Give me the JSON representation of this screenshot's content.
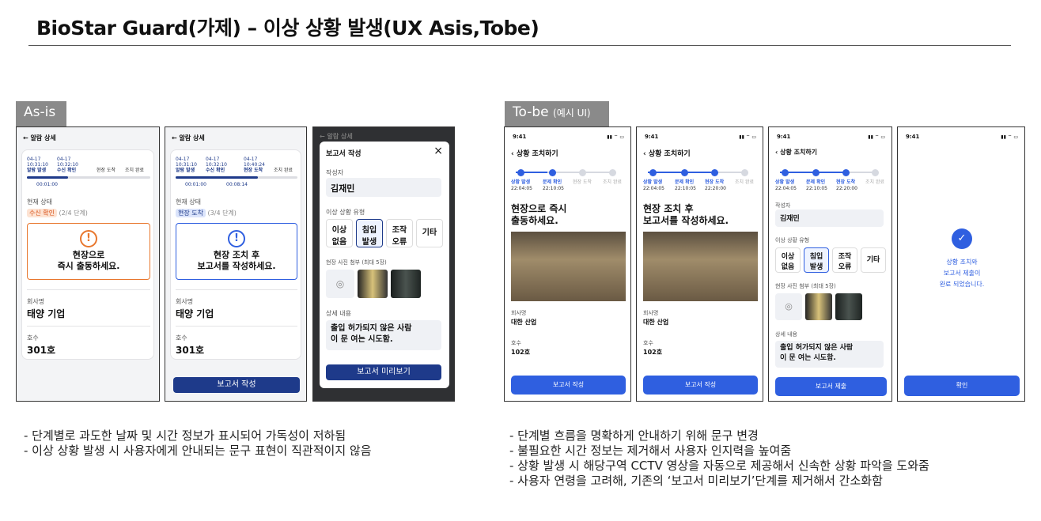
{
  "page_title": "BioStar Guard(가제) – 이상 상황 발생(UX Asis,Tobe)",
  "asis": {
    "tag": "As-is",
    "screen1": {
      "header": "알람 상세",
      "steps_top": [
        {
          "date": "04-17",
          "time": "10:31:10",
          "label": "알람 발생"
        },
        {
          "date": "04-17",
          "time": "10:32:10",
          "label": "수신 확인"
        },
        {
          "date": "",
          "time": "",
          "label": "현장 도착"
        },
        {
          "date": "",
          "time": "",
          "label": "조치 완료"
        }
      ],
      "elapsed": [
        "00:01:00"
      ],
      "status_label": "현재 상태",
      "status_badge": "수신 확인",
      "status_step": "(2/4 단계)",
      "alert_line1": "현장으로",
      "alert_line2": "즉시 출동하세요.",
      "company_label": "회사명",
      "company_value": "태양 기업",
      "room_label": "호수",
      "room_value": "301호"
    },
    "screen2": {
      "header": "알람 상세",
      "steps_top": [
        {
          "date": "04-17",
          "time": "10:31:10",
          "label": "알람 발생"
        },
        {
          "date": "04-17",
          "time": "10:32:10",
          "label": "수신 확인"
        },
        {
          "date": "04-17",
          "time": "10:40:24",
          "label": "현장 도착"
        },
        {
          "date": "",
          "time": "",
          "label": "조치 완료"
        }
      ],
      "elapsed": [
        "00:01:00",
        "00:08:14"
      ],
      "status_label": "현재 상태",
      "status_badge": "현장 도착",
      "status_step": "(3/4 단계)",
      "alert_line1": "현장 조치 후",
      "alert_line2": "보고서를 작성하세요.",
      "company_label": "회사명",
      "company_value": "태양 기업",
      "room_label": "호수",
      "room_value": "301호",
      "button": "보고서 작성"
    },
    "screen3": {
      "bg_header": "알람 상세",
      "modal_title": "보고서 작성",
      "close": "×",
      "author_label": "작성자",
      "author_value": "김재민",
      "type_label": "이상 상황 유형",
      "types": [
        {
          "l1": "이상",
          "l2": "없음"
        },
        {
          "l1": "침입",
          "l2": "발생"
        },
        {
          "l1": "조작",
          "l2": "오류"
        },
        {
          "l1": "기타",
          "l2": ""
        }
      ],
      "photo_label": "현장 사진 첨부 (최대 5장)",
      "detail_label": "상세 내용",
      "detail_line1": "출입 허가되지 않은 사람",
      "detail_line2": "이 문 여는 시도함.",
      "button": "보고서 미리보기"
    },
    "notes": [
      "- 단계별로 과도한 날짜 및 시간 정보가 표시되어 가독성이 저하됨",
      "- 이상 상황 발생 시 사용자에게 안내되는 문구 표현이 직관적이지 않음"
    ]
  },
  "tobe": {
    "tag": "To-be",
    "tag_sub": "(예시 UI)",
    "status_time": "9:41",
    "status_icons": "▮▮ ⌔ ▭",
    "header": "상황 조치하기",
    "steps": [
      {
        "label": "상황 발생",
        "time": "22:04:05"
      },
      {
        "label": "문제 확인",
        "time": "22:10:05"
      },
      {
        "label": "현장 도착",
        "time": "22:20:00"
      },
      {
        "label": "조치 완료",
        "time": ""
      }
    ],
    "screen1": {
      "heading1": "현장으로 즉시",
      "heading2": "출동하세요.",
      "company_label": "회사명",
      "company_value": "대한 산업",
      "room_label": "호수",
      "room_value": "102호",
      "button": "보고서 작성"
    },
    "screen2": {
      "heading1": "현장 조치 후",
      "heading2": "보고서를 작성하세요.",
      "company_label": "회사명",
      "company_value": "대한 산업",
      "room_label": "호수",
      "room_value": "102호",
      "button": "보고서 작성"
    },
    "screen3": {
      "author_label": "작성자",
      "author_value": "김재민",
      "type_label": "이상 상황 유형",
      "types": [
        {
          "l1": "이상",
          "l2": "없음"
        },
        {
          "l1": "침입",
          "l2": "발생"
        },
        {
          "l1": "조작",
          "l2": "오류"
        },
        {
          "l1": "기타",
          "l2": ""
        }
      ],
      "photo_label": "현장 사진 첨부 (최대 5장)",
      "detail_label": "상세 내용",
      "detail_line1": "출입 허가되지 않은 사람",
      "detail_line2": "이 문 여는 시도함.",
      "button": "보고서 제출"
    },
    "screen4": {
      "line1": "상황 조치와",
      "line2": "보고서 제출이",
      "line3": "완료 되었습니다.",
      "button": "확인"
    },
    "notes": [
      "- 단계별 흐름을 명확하게 안내하기 위해 문구 변경",
      "- 불필요한 시간 정보는 제거해서 사용자 인지력을 높여줌",
      "- 상황 발생 시 해당구역 CCTV 영상을 자동으로 제공해서 신속한 상황 파악을 도와줌",
      "- 사용자 연령을 고려해, 기존의 ‘보고서 미리보기’단계를 제거해서 간소화함"
    ]
  },
  "colors": {
    "navy": "#1e3a8a",
    "blue": "#2f5fe0",
    "orange": "#e8772e",
    "gray_tag": "#8a8a8a"
  }
}
